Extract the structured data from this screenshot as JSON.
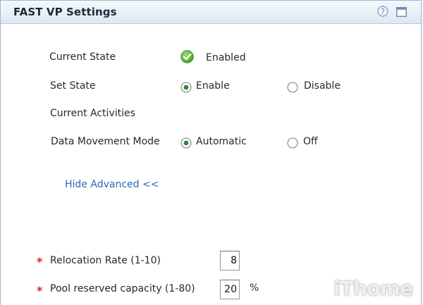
{
  "panel": {
    "title": "FAST VP Settings",
    "icons": {
      "help": "help-icon",
      "maximize": "maximize-icon"
    }
  },
  "current_state": {
    "label": "Current State",
    "value": "Enabled",
    "icon": "check-circle-icon",
    "icon_color": "#5cb82e"
  },
  "set_state": {
    "label": "Set State",
    "options": [
      {
        "label": "Enable",
        "selected": true
      },
      {
        "label": "Disable",
        "selected": false
      }
    ]
  },
  "current_activities": {
    "label": "Current Activities"
  },
  "data_movement_mode": {
    "label": "Data Movement Mode",
    "options": [
      {
        "label": "Automatic",
        "selected": true
      },
      {
        "label": "Off",
        "selected": false
      }
    ]
  },
  "advanced_toggle": {
    "label": "Hide Advanced <<"
  },
  "relocation_rate": {
    "label": "Relocation Rate (1-10)",
    "value": "8",
    "required_mark": "*"
  },
  "pool_reserved_capacity": {
    "label": "Pool reserved capacity (1-80)",
    "value": "20",
    "unit": "%",
    "required_mark": "*"
  },
  "watermark": {
    "text": "iThome"
  },
  "colors": {
    "accent_link": "#2a68b3",
    "required": "#d8232a",
    "radio_selected": "#2e8b2e"
  }
}
